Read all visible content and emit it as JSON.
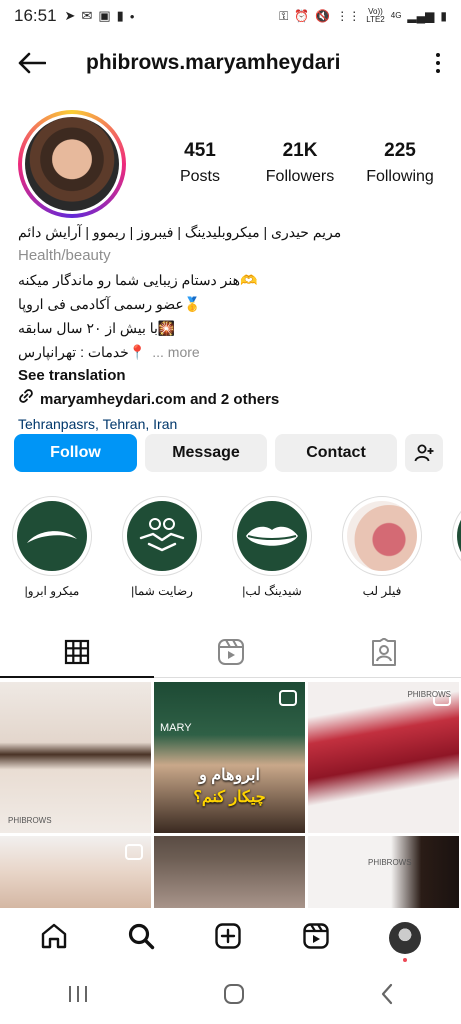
{
  "status_bar": {
    "time": "16:51",
    "network_top": "Vo))",
    "network_bottom": "LTE2",
    "net_type": "4G"
  },
  "header": {
    "username": "phibrows.maryamheydari"
  },
  "stats": [
    {
      "value": "451",
      "label": "Posts"
    },
    {
      "value": "21K",
      "label": "Followers"
    },
    {
      "value": "225",
      "label": "Following"
    }
  ],
  "bio": {
    "name": "مریم حیدری | میکروبلیدینگ | فیبروز | ریموو | آرایش دائم",
    "category": "Health/beauty",
    "line1": "🫶هنر دستام زیبایی شما رو ماندگار میکنه",
    "line2": "🥇عضو رسمی آکادمی فی اروپا",
    "line3": "🎇با بیش از ۲۰ سال سابقه",
    "line4": "📍خدمات : تهرانپارس",
    "more": "... more",
    "see_translation": "See translation",
    "link": "maryamheydari.com and 2 others",
    "location": "Tehranpasrs, Tehran, Iran"
  },
  "actions": {
    "follow": "Follow",
    "message": "Message",
    "contact": "Contact"
  },
  "highlights": [
    {
      "label": "|میکرو ابرو"
    },
    {
      "label": "|رضایت شما"
    },
    {
      "label": "|شیدینگ لب"
    },
    {
      "label": "فیلر لب"
    },
    {
      "label": "|"
    }
  ],
  "posts": {
    "caption_line1": "ابروهام و",
    "caption_line2": "چیکار کنم؟",
    "brand": "PHIBROWS",
    "side_brand": "MARY"
  },
  "colors": {
    "follow": "#0095f6",
    "button_bg": "#efefef",
    "highlight_green": "#1f4d36",
    "location": "#00376b"
  }
}
